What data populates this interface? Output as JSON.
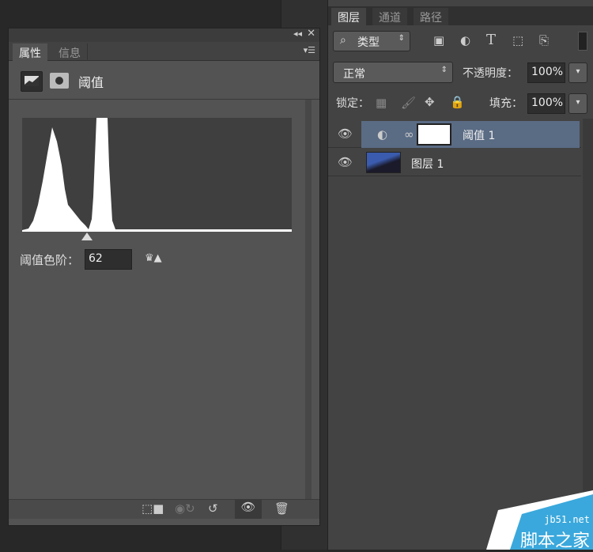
{
  "properties_panel": {
    "tabs": [
      {
        "label": "属性",
        "active": true
      },
      {
        "label": "信息",
        "active": false
      }
    ],
    "adjustment_title": "阈值",
    "threshold_label": "阈值色阶：",
    "threshold_value": "62",
    "threshold_level_max": 255
  },
  "layers_panel": {
    "tabs": [
      {
        "label": "图层",
        "active": true
      },
      {
        "label": "通道",
        "active": false
      },
      {
        "label": "路径",
        "active": false
      }
    ],
    "filter_kind": "类型",
    "blend_mode": "正常",
    "opacity_label": "不透明度：",
    "opacity_value": "100%",
    "lock_label": "锁定：",
    "fill_label": "填充：",
    "fill_value": "100%",
    "layers": [
      {
        "name": "阈值 1",
        "selected": true
      },
      {
        "name": "图层 1",
        "selected": false
      }
    ]
  },
  "watermark": {
    "site": "jb51.net",
    "name": "脚本之家",
    "color": "#3aa8dc"
  }
}
